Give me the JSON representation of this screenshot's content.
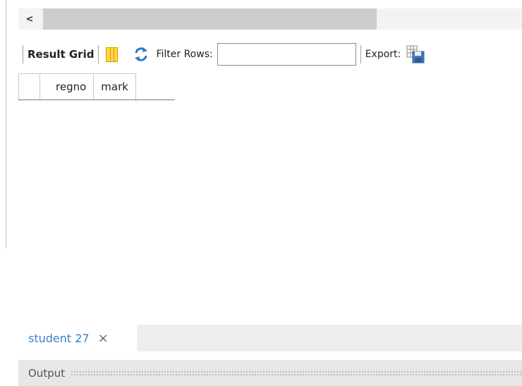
{
  "hscroll": {
    "left_arrow": "<"
  },
  "toolbar": {
    "result_grid_label": "Result Grid",
    "filter_rows_label": "Filter Rows:",
    "filter_value": "",
    "export_label": "Export:",
    "icons": [
      "columns-icon",
      "refresh-icon",
      "export-icon"
    ]
  },
  "grid": {
    "columns": [
      "regno",
      "mark"
    ],
    "rows": []
  },
  "tabs": [
    {
      "label": "student 27",
      "active": true
    }
  ],
  "output": {
    "label": "Output"
  },
  "colors": {
    "tab_text": "#3a7fc4",
    "scroll_thumb": "#cdcdcd",
    "refresh_icon": "#2b7bbf",
    "columns_icon": "#ffd54a"
  }
}
